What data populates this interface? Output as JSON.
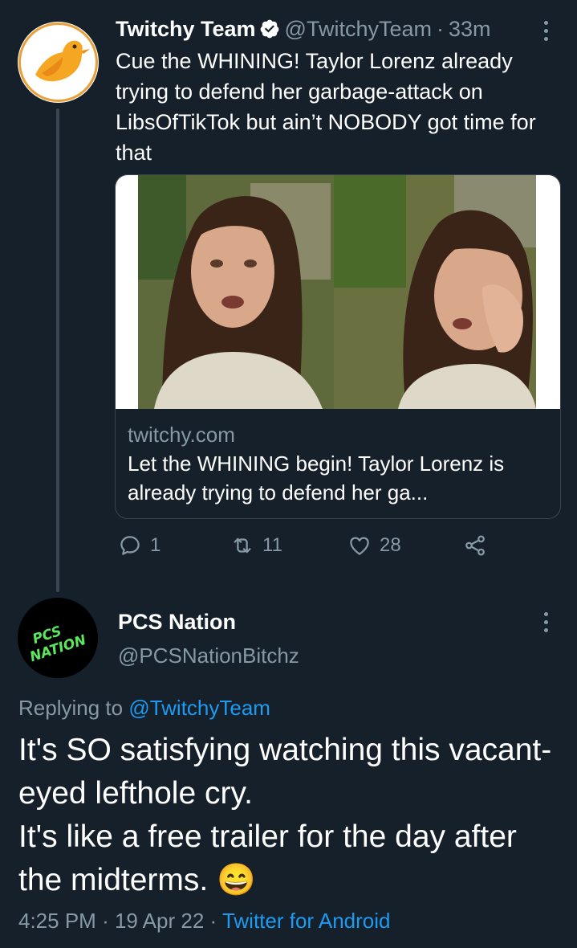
{
  "tweet1": {
    "author_name": "Twitchy Team",
    "handle": "@TwitchyTeam",
    "separator": "·",
    "time": "33m",
    "text": "Cue the WHINING! Taylor Lorenz already trying to defend her garbage-attack on LibsOfTikTok but ain’t NOBODY got time for that",
    "card": {
      "domain": "twitchy.com",
      "title": "Let the WHINING begin! Taylor Lorenz is already trying to defend her ga..."
    },
    "actions": {
      "replies": "1",
      "retweets": "11",
      "likes": "28"
    }
  },
  "tweet2": {
    "author_name": "PCS Nation",
    "handle": "@PCSNationBitchz",
    "avatar_text": "PCS NATION",
    "replying_prefix": "Replying to",
    "replying_to": "@TwitchyTeam",
    "text_line1": "It's SO satisfying watching this vacant-eyed lefthole cry.",
    "text_line2": "It's like a free trailer for the day after the midterms. ",
    "emoji": "😄",
    "time": "4:25 PM",
    "date": "19 Apr 22",
    "separator": "·",
    "source": "Twitter for Android"
  },
  "colors": {
    "background": "#15202b",
    "text": "#ffffff",
    "muted": "#8899a6",
    "accent": "#1d9bf0",
    "border": "#38444d"
  },
  "icons": [
    "twitchy-bird-icon",
    "verified-badge-icon",
    "more-options-icon",
    "reply-icon",
    "retweet-icon",
    "like-icon",
    "share-icon",
    "grinning-emoji"
  ]
}
